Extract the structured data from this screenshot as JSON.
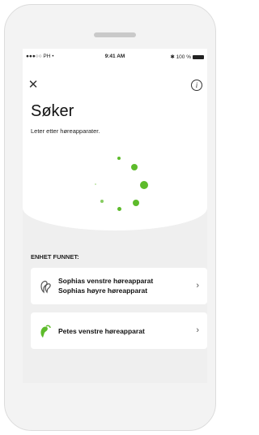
{
  "status_bar": {
    "signal": "●●●○○ PH •",
    "time": "9:41 AM",
    "battery": "✱ 100 %"
  },
  "header": {
    "close_icon": "close-icon",
    "info_icon": "info-icon",
    "title": "Søker",
    "subtitle": "Leter etter høreapparater."
  },
  "spinner": {
    "color": "#5dbb2b"
  },
  "devices_section": {
    "label": "ENHET FUNNET:",
    "devices": [
      {
        "icon": "hearing-aid-pair-icon",
        "line1": "Sophias venstre høreapparat",
        "line2": "Sophias høyre høreapparat"
      },
      {
        "icon": "hearing-aid-icon",
        "line1": "Petes venstre høreapparat"
      }
    ]
  }
}
